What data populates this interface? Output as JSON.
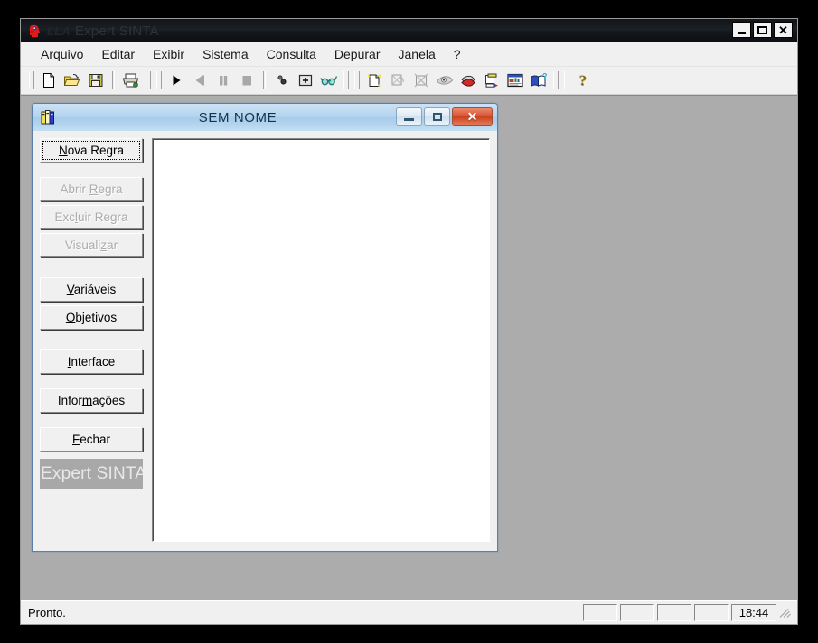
{
  "window": {
    "title_prefix": "LLA",
    "title": "Expert SINTA",
    "icon": "red-head-icon",
    "controls": {
      "minimize": "–",
      "maximize": "□",
      "close": "✕"
    }
  },
  "menubar": {
    "items": [
      {
        "label": "Arquivo"
      },
      {
        "label": "Editar"
      },
      {
        "label": "Exibir"
      },
      {
        "label": "Sistema"
      },
      {
        "label": "Consulta"
      },
      {
        "label": "Depurar"
      },
      {
        "label": "Janela"
      },
      {
        "label": "?"
      }
    ]
  },
  "toolbar": {
    "groups": [
      {
        "buttons": [
          {
            "name": "new-document-icon",
            "enabled": true
          },
          {
            "name": "open-folder-icon",
            "enabled": true
          },
          {
            "name": "save-floppy-icon",
            "enabled": true
          }
        ]
      },
      {
        "buttons": [
          {
            "name": "print-icon",
            "enabled": true
          }
        ]
      },
      {
        "buttons": [
          {
            "name": "run-play-icon",
            "enabled": true
          },
          {
            "name": "step-back-icon",
            "enabled": false
          },
          {
            "name": "pause-icon",
            "enabled": false
          },
          {
            "name": "stop-icon",
            "enabled": false
          }
        ]
      },
      {
        "buttons": [
          {
            "name": "breakpoint-icon",
            "enabled": true
          },
          {
            "name": "add-watch-icon",
            "enabled": true
          },
          {
            "name": "inspect-glasses-icon",
            "enabled": true
          }
        ]
      },
      {
        "buttons": [
          {
            "name": "new-rule-icon",
            "enabled": true
          },
          {
            "name": "open-rule-icon",
            "enabled": false
          },
          {
            "name": "delete-rule-icon",
            "enabled": false
          },
          {
            "name": "view-rule-eye-icon",
            "enabled": false
          },
          {
            "name": "variables-icon",
            "enabled": true
          },
          {
            "name": "objectives-icon",
            "enabled": true
          },
          {
            "name": "interface-icon",
            "enabled": true
          },
          {
            "name": "information-book-icon",
            "enabled": true
          }
        ]
      },
      {
        "buttons": [
          {
            "name": "help-question-icon",
            "enabled": true
          }
        ]
      }
    ]
  },
  "child_window": {
    "icon": "books-icon",
    "title": "SEM NOME",
    "controls": {
      "minimize": "–",
      "maximize": "□",
      "close": "✕"
    },
    "buttons": [
      {
        "name": "nova-regra-button",
        "label": "Nova Regra",
        "accel_index": 1,
        "enabled": true,
        "focused": true
      },
      {
        "name": "abrir-regra-button",
        "label": "Abrir Regra",
        "accel_index": 6,
        "enabled": false,
        "focused": false
      },
      {
        "name": "excluir-regra-button",
        "label": "Excluir Regra",
        "accel_index": 3,
        "enabled": false,
        "focused": false
      },
      {
        "name": "visualizar-button",
        "label": "Visualizar",
        "accel_index": 8,
        "enabled": false,
        "focused": false
      },
      {
        "name": "variaveis-button",
        "label": "Variáveis",
        "accel_index": 0,
        "enabled": true,
        "focused": false
      },
      {
        "name": "objetivos-button",
        "label": "Objetivos",
        "accel_index": 0,
        "enabled": true,
        "focused": false
      },
      {
        "name": "interface-button",
        "label": "Interface",
        "accel_index": 0,
        "enabled": true,
        "focused": false
      },
      {
        "name": "informacoes-button",
        "label": "Informações",
        "accel_index": 5,
        "enabled": true,
        "focused": false
      },
      {
        "name": "fechar-button",
        "label": "Fechar",
        "accel_index": 0,
        "enabled": true,
        "focused": false
      }
    ],
    "brand_label": "Expert SINTA",
    "rules_list": {
      "items": []
    }
  },
  "statusbar": {
    "message": "Pronto.",
    "panels": [
      "",
      "",
      "",
      ""
    ],
    "clock": "18:44"
  },
  "colors": {
    "mdi_background": "#acacac",
    "face": "#f0f0f0",
    "child_title_gradient_start": "#cde2f5",
    "child_title_gradient_end": "#c3def3",
    "close_button_red": "#d9512f",
    "brand_label_bg": "#a8a8a8",
    "disabled_text": "#acacac"
  }
}
